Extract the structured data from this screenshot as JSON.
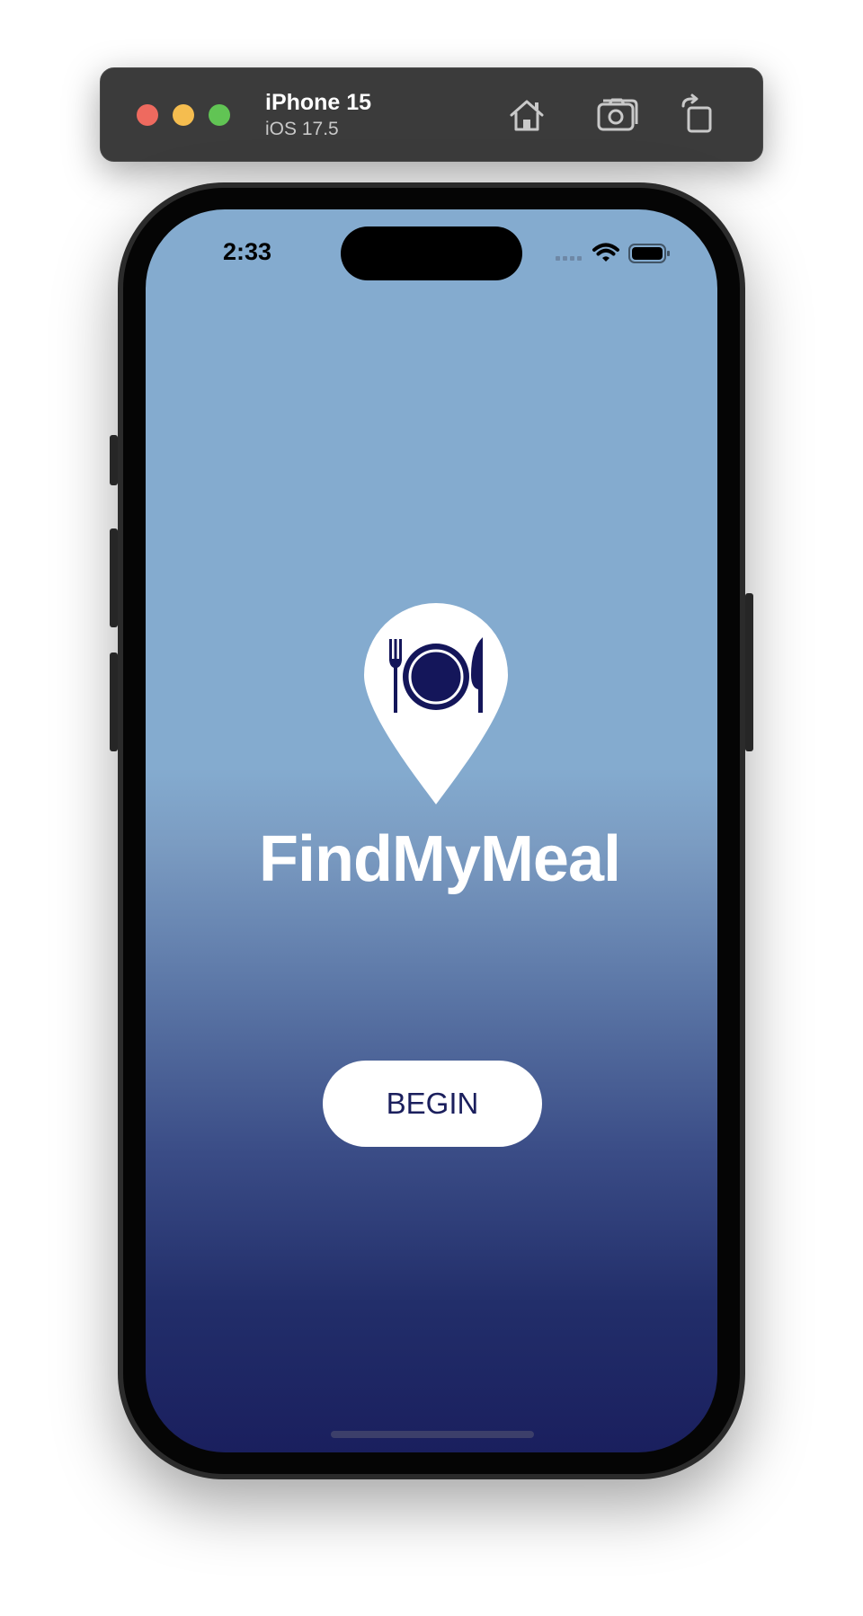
{
  "simulator": {
    "device_name": "iPhone 15",
    "os_version": "iOS 17.5",
    "traffic_lights": {
      "close": "#ee6a5f",
      "minimize": "#f5bd4f",
      "zoom": "#61c454"
    },
    "toolbar_icons": [
      "home-icon",
      "screenshot-icon",
      "rotate-icon"
    ]
  },
  "status_bar": {
    "time": "2:33",
    "icons": [
      "cellular-signal-icon",
      "wifi-icon",
      "battery-icon"
    ]
  },
  "app": {
    "logo_icon": "map-pin-plate-fork-knife-icon",
    "title": "FindMyMeal",
    "begin_label": "BEGIN"
  },
  "colors": {
    "gradient_top": "#84abcf",
    "gradient_bottom": "#1a1f5e",
    "accent_navy": "#1b1f5d",
    "button_bg": "#ffffff"
  }
}
